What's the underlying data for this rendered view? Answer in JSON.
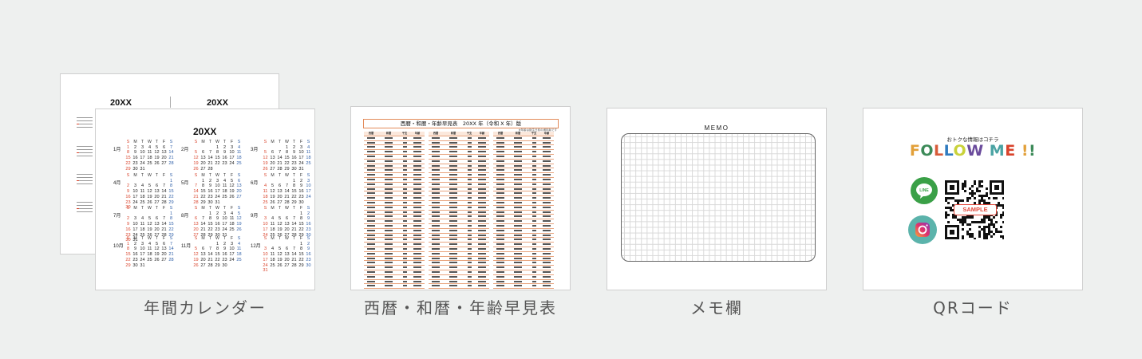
{
  "cards": [
    {
      "id": "calendar",
      "label": "年間カレンダー"
    },
    {
      "id": "wareki",
      "label": "西暦・和暦・年齢早見表"
    },
    {
      "id": "memo",
      "label": "メモ欄"
    },
    {
      "id": "qrcode",
      "label": "QRコード"
    }
  ],
  "calendar": {
    "back_title_left": "20XX",
    "back_title_right": "20XX",
    "front_title": "20XX",
    "weekday_headers": [
      "S",
      "M",
      "T",
      "W",
      "T",
      "F",
      "S"
    ],
    "months": [
      {
        "label": "1月",
        "lead": 0,
        "days": 31
      },
      {
        "label": "2月",
        "lead": 3,
        "days": 28
      },
      {
        "label": "3月",
        "lead": 3,
        "days": 31
      },
      {
        "label": "4月",
        "lead": 6,
        "days": 30
      },
      {
        "label": "5月",
        "lead": 1,
        "days": 31
      },
      {
        "label": "6月",
        "lead": 4,
        "days": 30
      },
      {
        "label": "7月",
        "lead": 6,
        "days": 31
      },
      {
        "label": "8月",
        "lead": 2,
        "days": 31
      },
      {
        "label": "9月",
        "lead": 5,
        "days": 30
      },
      {
        "label": "10月",
        "lead": 0,
        "days": 31
      },
      {
        "label": "11月",
        "lead": 3,
        "days": 30
      },
      {
        "label": "12月",
        "lead": 5,
        "days": 31
      }
    ],
    "colors": {
      "sunday": "#d9432b",
      "saturday": "#2f5fa8"
    }
  },
  "wareki": {
    "title": "西暦・和暦・年齢早見表　20XX 年（令和 X 年）版",
    "note": "※年齢は誕生日前の満年齢です",
    "headers": [
      "西暦",
      "和暦",
      "干支",
      "年齢"
    ]
  },
  "memo": {
    "title": "MEMO"
  },
  "qr": {
    "small_text": "おトクな情報はコチラ",
    "follow_text": "FOLLOW ME !!",
    "sample_label": "SAMPLE",
    "icons": [
      "line-icon",
      "instagram-icon"
    ]
  }
}
